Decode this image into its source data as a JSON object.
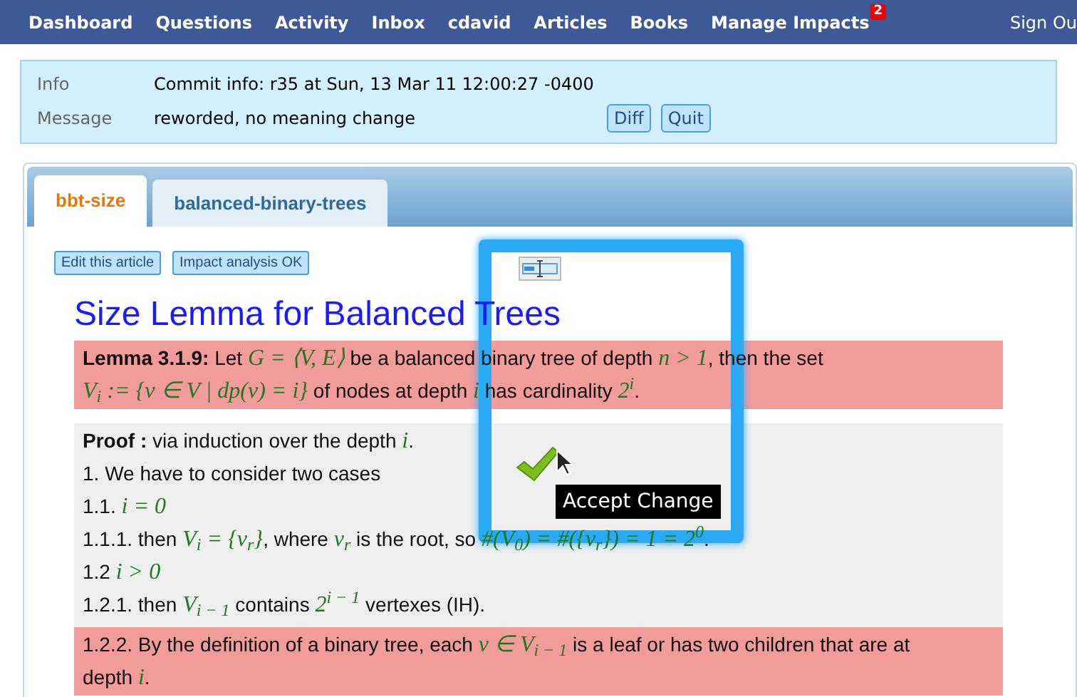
{
  "nav": {
    "items": [
      {
        "label": "Dashboard"
      },
      {
        "label": "Questions"
      },
      {
        "label": "Activity"
      },
      {
        "label": "Inbox"
      },
      {
        "label": "cdavid"
      },
      {
        "label": "Articles"
      },
      {
        "label": "Books"
      },
      {
        "label": "Manage Impacts",
        "badge": "2"
      }
    ],
    "sign_out": "Sign Ou"
  },
  "commit": {
    "rows": [
      {
        "label": "Info",
        "value": "Commit info: r35 at Sun, 13 Mar 11 12:00:27 -0400"
      },
      {
        "label": "Message",
        "value": "reworded, no meaning change"
      }
    ],
    "buttons": [
      "Diff",
      "Quit"
    ]
  },
  "tabs": [
    {
      "label": "bbt-size",
      "selected": true
    },
    {
      "label": "balanced-binary-trees",
      "selected": false
    }
  ],
  "article_buttons": [
    "Edit this article",
    "Impact analysis OK"
  ],
  "title": "Size Lemma for Balanced Trees",
  "blocks": [
    {
      "changed": true,
      "lines": [
        [
          {
            "kind": "bold",
            "s": "Lemma 3.1.9:"
          },
          {
            "kind": "text",
            "s": " Let "
          },
          {
            "kind": "math",
            "s": "G = ⟨V, E⟩"
          },
          {
            "kind": "text",
            "s": " be a balanced binary tree of depth "
          },
          {
            "kind": "math",
            "s": "n > 1"
          },
          {
            "kind": "text",
            "s": ", then the set"
          }
        ],
        [
          {
            "kind": "math",
            "s": "V$_{i}$ := {v ∈ V | dp(v) = i}"
          },
          {
            "kind": "text",
            "s": " of nodes at depth "
          },
          {
            "kind": "math",
            "s": "i"
          },
          {
            "kind": "text",
            "s": " has cardinality "
          },
          {
            "kind": "math",
            "s": "2$^{i}$"
          },
          {
            "kind": "text",
            "s": "."
          }
        ]
      ]
    },
    {
      "changed": false,
      "lines": [
        [
          {
            "kind": "bold",
            "s": "Proof :"
          },
          {
            "kind": "text",
            "s": " via induction over the depth "
          },
          {
            "kind": "math",
            "s": "i"
          },
          {
            "kind": "text",
            "s": "."
          }
        ],
        [
          {
            "kind": "text",
            "s": "1. We have to consider two cases"
          }
        ],
        [
          {
            "kind": "text",
            "s": "1.1. "
          },
          {
            "kind": "math",
            "s": "i = 0"
          }
        ],
        [
          {
            "kind": "text",
            "s": "1.1.1. then "
          },
          {
            "kind": "math",
            "s": "V$_{i}$ = {v$_{r}$}"
          },
          {
            "kind": "text",
            "s": ", where "
          },
          {
            "kind": "math",
            "s": "v$_{r}$"
          },
          {
            "kind": "text",
            "s": " is the root, so "
          },
          {
            "kind": "math",
            "s": "#(V$_{0}$) = #({v$_{r}$}) = 1 = 2$^{0}$"
          },
          {
            "kind": "text",
            "s": "."
          }
        ],
        [
          {
            "kind": "text",
            "s": "1.2 "
          },
          {
            "kind": "math",
            "s": "i > 0"
          }
        ],
        [
          {
            "kind": "text",
            "s": "1.2.1. then "
          },
          {
            "kind": "math",
            "s": "V$_{i − 1}$"
          },
          {
            "kind": "text",
            "s": " contains "
          },
          {
            "kind": "math",
            "s": "2$^{i − 1}$"
          },
          {
            "kind": "text",
            "s": " vertexes (IH)."
          }
        ]
      ]
    },
    {
      "changed": true,
      "lines": [
        [
          {
            "kind": "text",
            "s": "1.2.2. By the definition of a binary tree, each "
          },
          {
            "kind": "math",
            "s": "v ∈ V$_{i − 1}$"
          },
          {
            "kind": "text",
            "s": " is a leaf or has two children that are at"
          }
        ],
        [
          {
            "kind": "text",
            "s": "depth "
          },
          {
            "kind": "math",
            "s": "i"
          },
          {
            "kind": "text",
            "s": "."
          }
        ]
      ]
    }
  ],
  "tooltip": "Accept Change"
}
